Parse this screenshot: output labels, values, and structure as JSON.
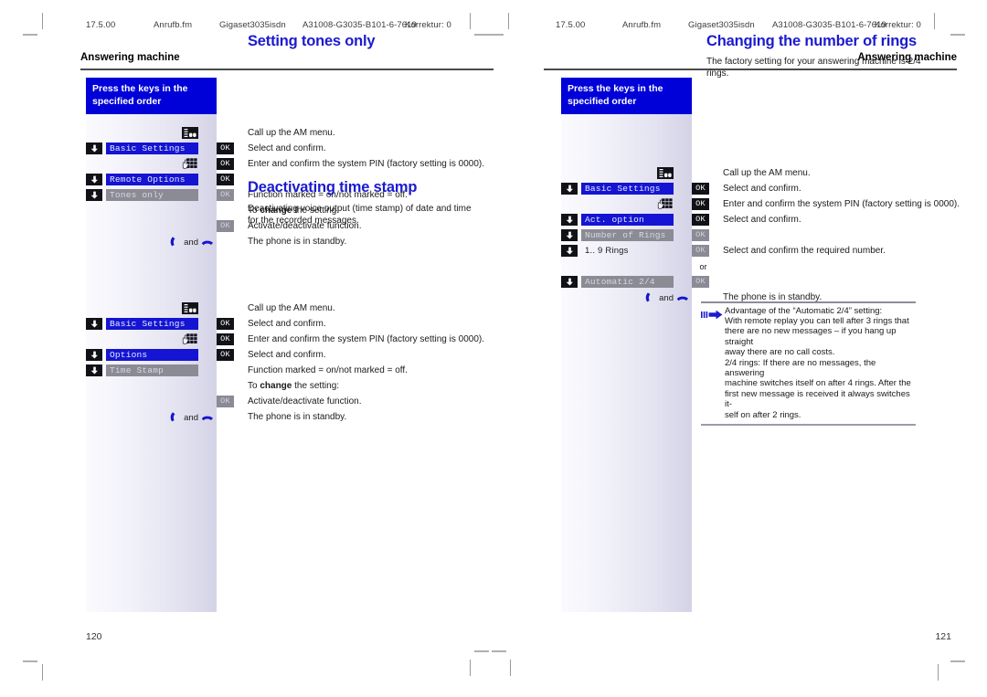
{
  "document": {
    "meta_line": [
      "17.5.00",
      "Anrufb.fm",
      "Gigaset3035isdn",
      "A31008-G3035-B101-6-7619",
      "Korrektur: 0"
    ]
  },
  "left_page": {
    "running_head": "Answering machine",
    "folio": "120",
    "key_column_head": "Press the keys in the\nspecified order",
    "sections": [
      {
        "title": "Setting tones only",
        "steps": [
          {
            "nav": false,
            "display": null,
            "display_style": null,
            "icon": "am-menu-icon",
            "ok": null,
            "text": "Call up the AM menu."
          },
          {
            "nav": true,
            "display": "Basic Settings",
            "display_style": "selected",
            "icon": null,
            "ok": "OK",
            "ok_style": "on",
            "text": "Select and confirm."
          },
          {
            "nav": false,
            "display": null,
            "display_style": null,
            "icon": "keypad-icon",
            "ok": "OK",
            "ok_style": "on",
            "text": "Enter and confirm the system PIN (factory setting is 0000)."
          },
          {
            "nav": true,
            "display": "Remote Options",
            "display_style": "selected",
            "icon": null,
            "ok": "OK",
            "ok_style": "on",
            "text": ""
          },
          {
            "nav": true,
            "display": "Tones only",
            "display_style": "grey",
            "icon": null,
            "ok": "OK",
            "ok_style": "off",
            "text": "Function marked = on/not marked = off."
          },
          {
            "nav": false,
            "display": null,
            "display_style": null,
            "icon": null,
            "ok": null,
            "text_html": "To <b>change</b> the setting:"
          },
          {
            "nav": false,
            "display": null,
            "display_style": null,
            "icon": null,
            "ok": "OK",
            "ok_style": "off",
            "text": "Activate/deactivate function."
          },
          {
            "nav": false,
            "display": null,
            "display_style": null,
            "icon": "handsets",
            "ok": null,
            "text": "The phone is in standby."
          }
        ]
      },
      {
        "title": "Deactivating time stamp",
        "intro": "Deactivating voice output (time stamp) of date and time for the recorded messages.",
        "steps": [
          {
            "nav": false,
            "display": null,
            "display_style": null,
            "icon": "am-menu-icon",
            "ok": null,
            "text": "Call up the AM menu."
          },
          {
            "nav": true,
            "display": "Basic Settings",
            "display_style": "selected",
            "icon": null,
            "ok": "OK",
            "ok_style": "on",
            "text": "Select and confirm."
          },
          {
            "nav": false,
            "display": null,
            "display_style": null,
            "icon": "keypad-icon",
            "ok": "OK",
            "ok_style": "on",
            "text": "Enter and confirm the system PIN (factory setting is 0000)."
          },
          {
            "nav": true,
            "display": "Options",
            "display_style": "selected",
            "icon": null,
            "ok": "OK",
            "ok_style": "on",
            "text": "Select and confirm."
          },
          {
            "nav": true,
            "display": "Time Stamp",
            "display_style": "grey",
            "icon": null,
            "ok": null,
            "text": "Function marked = on/not marked = off."
          },
          {
            "nav": false,
            "display": null,
            "display_style": null,
            "icon": null,
            "ok": null,
            "text_html": "To <b>change</b> the setting:"
          },
          {
            "nav": false,
            "display": null,
            "display_style": null,
            "icon": null,
            "ok": "OK",
            "ok_style": "off",
            "text": "Activate/deactivate function."
          },
          {
            "nav": false,
            "display": null,
            "display_style": null,
            "icon": "handsets",
            "ok": null,
            "text": "The phone is in standby."
          }
        ]
      }
    ]
  },
  "right_page": {
    "running_head": "Answering machine",
    "folio": "121",
    "key_column_head": "Press the keys in the\nspecified order",
    "section": {
      "title": "Changing the number of rings",
      "intro": "The factory setting for your answering machine is  2/4 rings.",
      "steps": [
        {
          "nav": false,
          "display": null,
          "display_style": null,
          "icon": "am-menu-icon",
          "ok": null,
          "text": "Call up the AM menu."
        },
        {
          "nav": true,
          "display": "Basic Settings",
          "display_style": "selected",
          "icon": null,
          "ok": "OK",
          "ok_style": "on",
          "text": "Select and confirm."
        },
        {
          "nav": false,
          "display": null,
          "display_style": null,
          "icon": "keypad-icon",
          "ok": "OK",
          "ok_style": "on",
          "text": "Enter and confirm the system PIN (factory setting is 0000)."
        },
        {
          "nav": true,
          "display": "Act. option",
          "display_style": "selected",
          "icon": null,
          "ok": "OK",
          "ok_style": "on",
          "text": "Select and confirm."
        },
        {
          "nav": true,
          "display": "Number of Rings",
          "display_style": "grey",
          "icon": null,
          "ok": "OK",
          "ok_style": "off",
          "text": ""
        },
        {
          "nav": true,
          "display": "1.. 9 Rings",
          "display_style": "plain",
          "icon": null,
          "ok": "OK",
          "ok_style": "off",
          "text": "Select and confirm the required number."
        },
        {
          "nav": false,
          "display": null,
          "display_style": null,
          "icon": null,
          "ok": null,
          "or": "or",
          "text": ""
        },
        {
          "nav": true,
          "display": "Automatic 2/4",
          "display_style": "grey",
          "icon": null,
          "ok": "OK",
          "ok_style": "off",
          "text": ""
        },
        {
          "nav": false,
          "display": null,
          "display_style": null,
          "icon": "handsets",
          "ok": null,
          "text": "The phone is in standby."
        }
      ]
    },
    "note": {
      "lines": [
        "Advantage of the “Automatic 2/4” setting:",
        "With remote replay you can tell after 3 rings that",
        "there are no new messages – if you hang up straight",
        "away there are no call costs.",
        "2/4 rings: If there are no messages, the answering",
        "machine switches itself on after 4 rings. After the",
        "first new message is received it always switches it-",
        "self on after 2 rings."
      ]
    }
  },
  "labels": {
    "and": "and"
  },
  "colors": {
    "heading_blue": "#1a1ad0",
    "banner_blue": "#0000d8",
    "display_select": "#1414d2",
    "display_grey": "#8b8b96",
    "key_black": "#111118"
  }
}
